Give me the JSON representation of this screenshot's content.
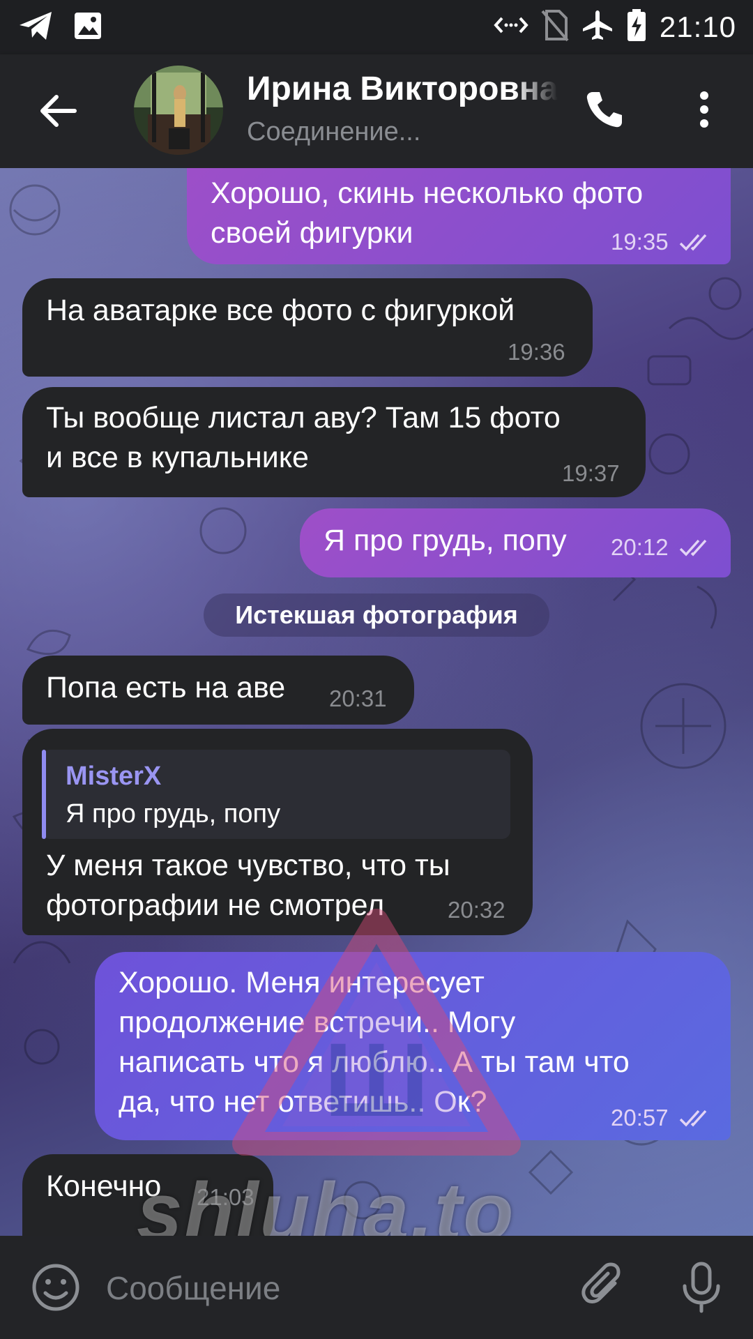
{
  "status_bar": {
    "time": "21:10",
    "icons": [
      "telegram-icon",
      "image-icon",
      "data-saver-icon",
      "no-sim-icon",
      "airplane-icon",
      "battery-charging-icon"
    ]
  },
  "header": {
    "contact_name": "Ирина Викторовна",
    "status": "Соединение...",
    "icons": [
      "back-arrow-icon",
      "phone-icon",
      "more-vert-icon"
    ]
  },
  "messages": [
    {
      "direction": "out",
      "text": "Хорошо, скинь несколько фото\nсвоей фигурки",
      "time": "19:35",
      "read": true
    },
    {
      "direction": "in",
      "text": "На аватарке все фото с фигуркой",
      "time": "19:36"
    },
    {
      "direction": "in",
      "text": "Ты вообще листал аву? Там 15 фото\nи все в купальнике",
      "time": "19:37"
    },
    {
      "direction": "out",
      "text": "Я про грудь, попу",
      "time": "20:12",
      "read": true
    },
    {
      "direction": "service",
      "text": "Истекшая фотография"
    },
    {
      "direction": "in",
      "text": "Попа есть на аве",
      "time": "20:31"
    },
    {
      "direction": "in",
      "reply": {
        "author": "MisterX",
        "text": "Я про грудь, попу"
      },
      "text": "У меня такое чувство, что ты\nфотографии не смотрел",
      "time": "20:32"
    },
    {
      "direction": "out",
      "text": "Хорошо. Меня интересует\nпродолжение встречи.. Могу\nнаписать что я люблю.. А ты там что\nда, что нет ответишь.. Ок?",
      "time": "20:57",
      "read": true
    },
    {
      "direction": "in",
      "text": "Конечно",
      "time": "21:03"
    }
  ],
  "watermark": {
    "text": "shluha.to",
    "glyph": "Ш"
  },
  "composer": {
    "placeholder": "Сообщение",
    "value": "",
    "icons": [
      "emoji-icon",
      "attach-icon",
      "microphone-icon"
    ]
  },
  "colors": {
    "incoming_bubble": "#232426",
    "outgoing_bubble": "#8d4fcd",
    "outgoing_bubble_blue": "#6460dd",
    "header_bg": "#232427",
    "reply_accent": "#9a95f2"
  }
}
